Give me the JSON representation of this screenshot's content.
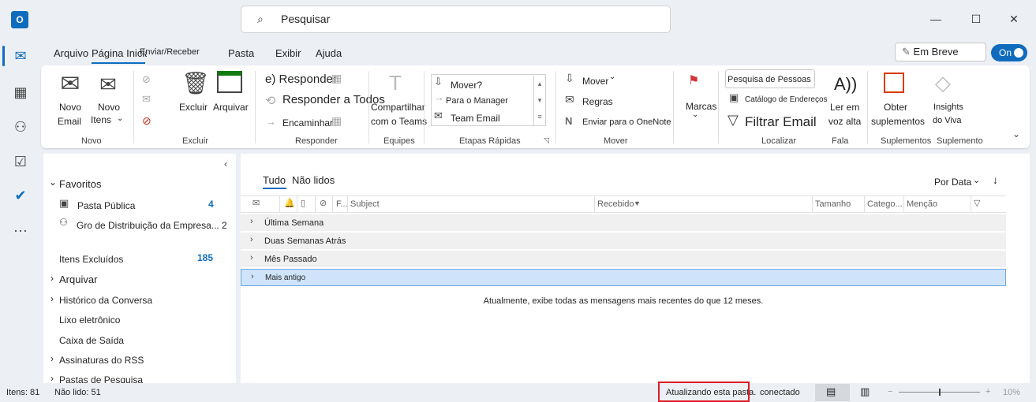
{
  "app": {
    "logo_letter": "O"
  },
  "search": {
    "placeholder": "Pesquisar"
  },
  "window_controls": {
    "minimize": "—",
    "maximize": "☐",
    "close": "✕"
  },
  "menu_tabs": [
    "Arquivo",
    "Página Inicial",
    "Enviar/Receber",
    "Pasta",
    "Exibir",
    "Ajuda"
  ],
  "coming_soon": {
    "label": "Em Breve",
    "toggle": "On"
  },
  "ribbon": {
    "new_mail": "Novo Email",
    "new_mail_line1": "Novo",
    "new_mail_line2": "Email",
    "new_items_line1": "Novo",
    "new_items_line2": "Itens",
    "group_new": "Novo",
    "delete": "Excluir",
    "archive": "Arquivar",
    "group_delete": "Excluir",
    "reply": "e) Responder",
    "reply_all": "Responder a Todos",
    "forward": "Encaminhar",
    "group_respond": "Responder",
    "share_teams_1": "Compartilhar",
    "share_teams_2": "com o Teams",
    "group_teams": "Equipes",
    "quick_move": "Mover?",
    "quick_manager": "Para o Manager",
    "quick_team_email": "Team Email",
    "group_quick": "Etapas Rápidas",
    "move": "Mover",
    "rules": "Regras",
    "onenote": "Enviar para o OneNote",
    "group_move": "Mover",
    "tags": "Marcas",
    "people_search": "Pesquisa de Pessoas",
    "address_book": "Catálogo de Endereços",
    "filter_email": "Filtrar Email",
    "group_find": "Localizar",
    "read_aloud_icon": "A))",
    "read_aloud_1": "Ler em",
    "read_aloud_2": "voz alta",
    "group_speech": "Fala",
    "get_addins_1": "Obter",
    "get_addins_2": "suplementos",
    "group_addins": "Suplementos",
    "viva_1": "Insights",
    "viva_2": "do Viva",
    "group_addin": "Suplemento"
  },
  "folders": {
    "favorites": "Favoritos",
    "public_folder": "Pasta Pública",
    "public_count": "4",
    "distribution": "Gro de Distribuição da Empresa...",
    "distribution_count": "2",
    "deleted": "Itens Excluídos",
    "deleted_count": "185",
    "archive": "Arquivar",
    "history": "Histórico da Conversa",
    "junk": "Lixo eletrônico",
    "outbox": "Caixa de Saída",
    "rss": "Assinaturas do RSS",
    "search_folders": "Pastas de Pesquisa"
  },
  "mail_list": {
    "tab_all": "Tudo",
    "tab_unread": "Não lidos",
    "sort": "Por Data",
    "col_from": "F...",
    "col_subject": "Subject",
    "col_received": "Recebido",
    "col_size": "Tamanho",
    "col_category": "Catego...",
    "col_mention": "Menção",
    "groups": [
      "Última Semana",
      "Duas Semanas Atrás",
      "Mês Passado",
      "Mais antigo"
    ],
    "info": "Atualmente, exibe todas as mensagens mais recentes do que 12 meses."
  },
  "status": {
    "items": "Itens: 81",
    "unread": "Não lido: 51",
    "syncing": "Atualizando esta pasta.",
    "connected": "conectado",
    "zoom": "10%"
  },
  "colors": {
    "accent": "#0f6cbd",
    "highlight_box": "#e01b24"
  }
}
